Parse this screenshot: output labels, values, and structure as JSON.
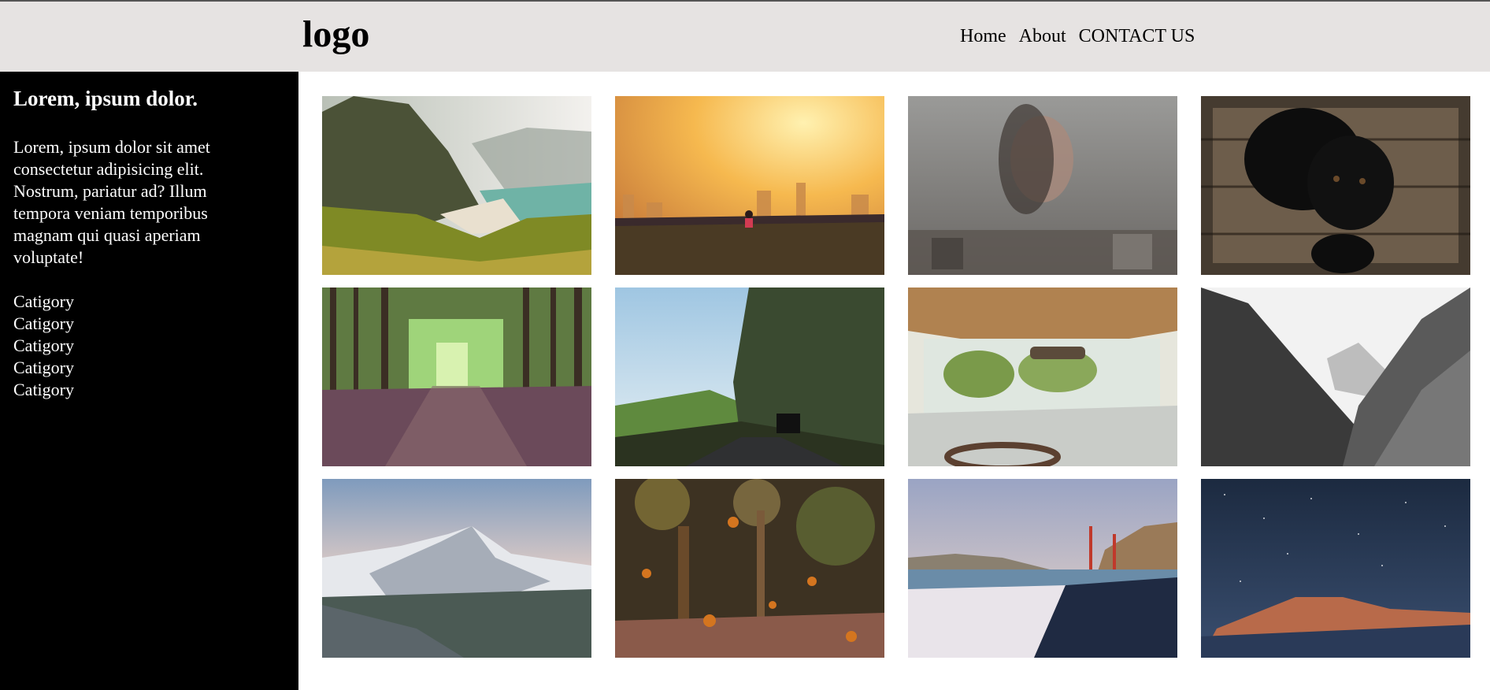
{
  "header": {
    "logo": "logo",
    "nav": [
      "Home",
      "About",
      "CONTACT US"
    ]
  },
  "sidebar": {
    "title": "Lorem, ipsum dolor.",
    "text": "Lorem, ipsum dolor sit amet consectetur adipisicing elit. Nostrum, pariatur ad? Illum tempora veniam temporibus magnam qui quasi aperiam voluptate!",
    "categories": [
      "Catigory",
      "Catigory",
      "Catigory",
      "Catigory",
      "Catigory"
    ]
  },
  "gallery": [
    {
      "name": "mountain-beach-photo"
    },
    {
      "name": "sunset-runner-photo"
    },
    {
      "name": "woman-window-photo"
    },
    {
      "name": "black-puppy-photo"
    },
    {
      "name": "forest-path-photo"
    },
    {
      "name": "cliff-road-photo"
    },
    {
      "name": "vintage-car-interior-photo"
    },
    {
      "name": "misty-valley-photo"
    },
    {
      "name": "snowy-mountain-photo"
    },
    {
      "name": "autumn-leaves-photo"
    },
    {
      "name": "golden-gate-beach-photo"
    },
    {
      "name": "starry-night-photo"
    }
  ],
  "colors": {
    "header_bg": "#e6e3e2",
    "sidebar_bg": "#000000",
    "page_bg": "#ffffff"
  }
}
